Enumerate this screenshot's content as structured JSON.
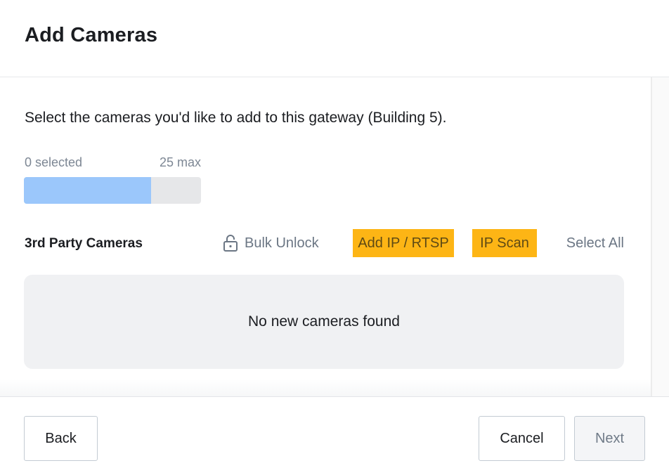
{
  "header": {
    "title": "Add Cameras"
  },
  "body": {
    "instruction": "Select the cameras you'd like to add to this gateway (Building 5).",
    "selection": {
      "selected_label": "0 selected",
      "max_label": "25 max",
      "progress_fill_fraction": 0.72
    },
    "section": {
      "title": "3rd Party Cameras",
      "actions": {
        "bulk_unlock_label": "Bulk Unlock",
        "bulk_unlock_icon": "lock-icon",
        "add_ip_label": "Add IP / RTSP",
        "ip_scan_label": "IP Scan",
        "select_all_label": "Select All"
      }
    },
    "empty_state": "No new cameras found"
  },
  "footer": {
    "back_label": "Back",
    "cancel_label": "Cancel",
    "next_label": "Next",
    "next_disabled": true
  },
  "colors": {
    "accent_yellow": "#fdb515",
    "progress_fill": "#9bc7fb",
    "progress_track": "#e6e7e9",
    "muted_text": "#6b7684"
  }
}
